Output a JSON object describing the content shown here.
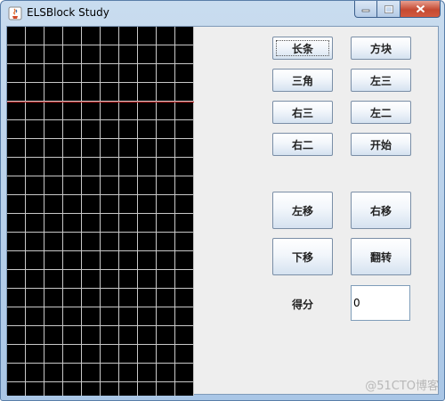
{
  "window": {
    "title": "ELSBlock Study"
  },
  "buttons": {
    "long_bar": "长条",
    "square": "方块",
    "triangle": "三角",
    "left_three": "左三",
    "right_three": "右三",
    "left_two": "左二",
    "right_two": "右二",
    "start": "开始",
    "move_left": "左移",
    "move_right": "右移",
    "move_down": "下移",
    "rotate": "翻转"
  },
  "score": {
    "label": "得分",
    "value": "0"
  },
  "watermark": "@51CTO博客",
  "colors": {
    "board": "#000000",
    "grid": "#c8c8c8",
    "limit_line": "#c02020"
  }
}
